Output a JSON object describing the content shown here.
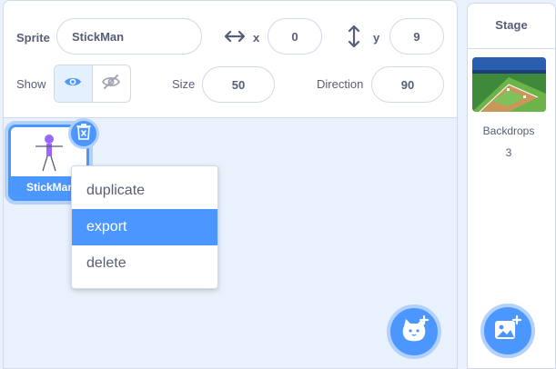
{
  "sprite_info": {
    "sprite_label": "Sprite",
    "sprite_name": "StickMan",
    "x_label": "x",
    "x_value": "0",
    "y_label": "y",
    "y_value": "9",
    "show_label": "Show",
    "size_label": "Size",
    "size_value": "50",
    "direction_label": "Direction",
    "direction_value": "90"
  },
  "sprite_list": {
    "items": [
      {
        "name": "StickMan",
        "selected": true
      }
    ]
  },
  "context_menu": {
    "items": [
      {
        "label": "duplicate",
        "highlighted": false
      },
      {
        "label": "export",
        "highlighted": true
      },
      {
        "label": "delete",
        "highlighted": false
      }
    ]
  },
  "stage": {
    "title": "Stage",
    "backdrops_label": "Backdrops",
    "backdrops_count": "3"
  },
  "colors": {
    "accent": "#4c97ff",
    "pane_bg": "#e9f1fc",
    "text": "#575e75"
  },
  "icons": {
    "show_visible": "eye-icon",
    "show_hidden": "eye-slash-icon",
    "delete": "trash-icon",
    "choose_sprite": "cat-plus-icon",
    "choose_backdrop": "image-plus-icon"
  }
}
